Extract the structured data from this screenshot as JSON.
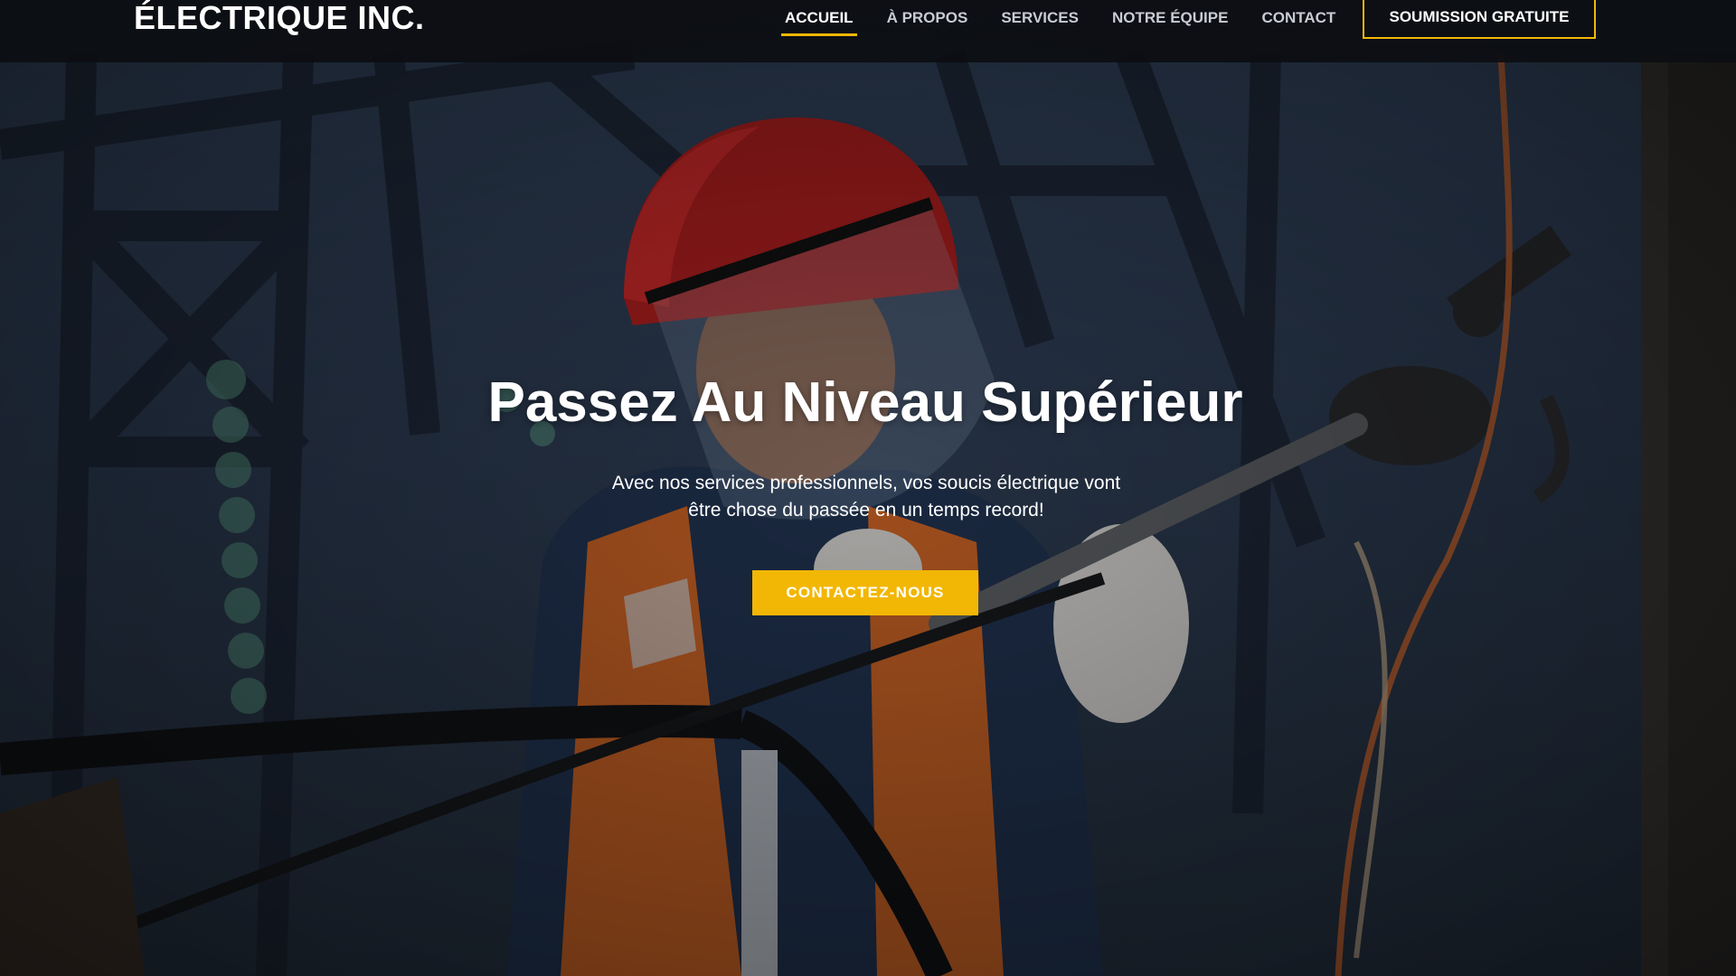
{
  "header": {
    "logo": "ÉLECTRIQUE INC.",
    "nav": [
      {
        "label": "ACCUEIL",
        "active": true
      },
      {
        "label": "À PROPOS",
        "active": false
      },
      {
        "label": "SERVICES",
        "active": false
      },
      {
        "label": "NOTRE ÉQUIPE",
        "active": false
      },
      {
        "label": "CONTACT",
        "active": false
      }
    ],
    "cta_label": "SOUMISSION GRATUITE"
  },
  "hero": {
    "title": "Passez Au Niveau Supérieur",
    "subtitle_line1": "Avec nos services professionnels, vos soucis électrique vont",
    "subtitle_line2": "être chose du passée en un temps record!",
    "button_label": "CONTACTEZ-NOUS"
  },
  "colors": {
    "accent": "#f2b705",
    "header_bg": "#0c0e12",
    "text": "#ffffff",
    "nav_text": "#c9ccd2"
  }
}
